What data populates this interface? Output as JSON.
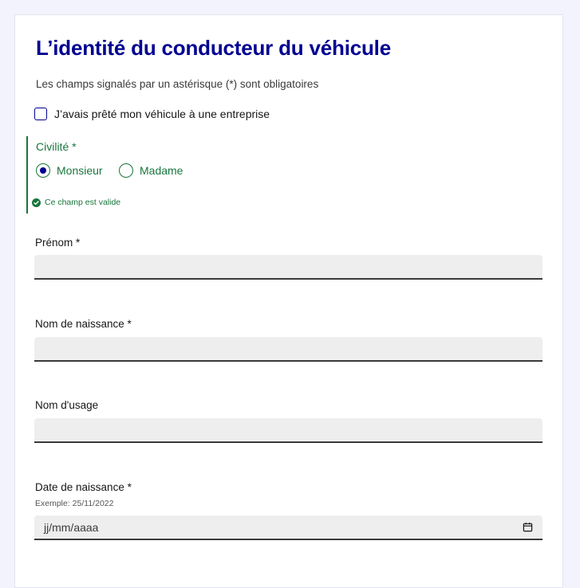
{
  "form": {
    "title": "L’identité du conducteur du véhicule",
    "mandatory_note": "Les champs signalés par un astérisque (*) sont obligatoires",
    "company_checkbox": {
      "label": "J’avais prêté mon véhicule à une entreprise",
      "checked": false
    },
    "civility": {
      "legend": "Civilité *",
      "options": [
        {
          "label": "Monsieur",
          "selected": true
        },
        {
          "label": "Madame",
          "selected": false
        }
      ],
      "valid_message": "Ce champ est valide"
    },
    "first_name": {
      "label": "Prénom *",
      "value": ""
    },
    "birth_name": {
      "label": "Nom de naissance *",
      "value": ""
    },
    "usage_name": {
      "label": "Nom d'usage",
      "value": ""
    },
    "birth_date": {
      "label": "Date de naissance *",
      "hint": "Exemple: 25/11/2022",
      "placeholder": "jj/mm/aaaa"
    }
  },
  "colors": {
    "title": "#000091",
    "valid": "#18753c",
    "page_background": "#f3f3fd",
    "input_background": "#eeeeee"
  },
  "icons": {
    "valid": "check-circle-icon",
    "date": "calendar-icon"
  }
}
